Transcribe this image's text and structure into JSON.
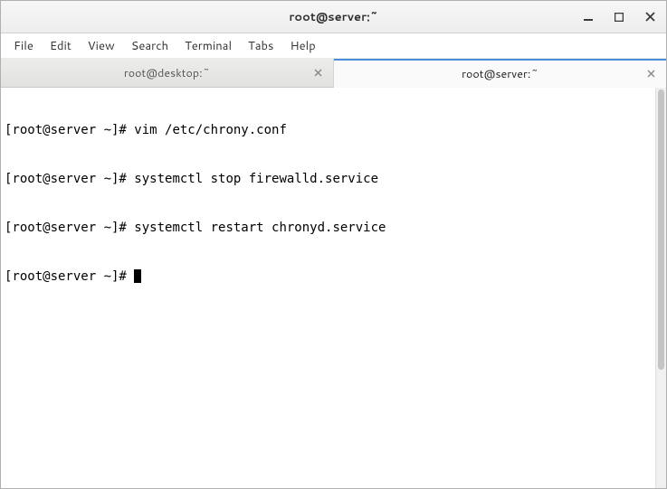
{
  "window": {
    "title": "root@server:~"
  },
  "menubar": {
    "items": [
      {
        "label": "File"
      },
      {
        "label": "Edit"
      },
      {
        "label": "View"
      },
      {
        "label": "Search"
      },
      {
        "label": "Terminal"
      },
      {
        "label": "Tabs"
      },
      {
        "label": "Help"
      }
    ]
  },
  "tabs": [
    {
      "label": "root@desktop:~",
      "active": false
    },
    {
      "label": "root@server:~",
      "active": true
    }
  ],
  "terminal": {
    "lines": [
      {
        "prompt": "[root@server ~]# ",
        "command": "vim /etc/chrony.conf"
      },
      {
        "prompt": "[root@server ~]# ",
        "command": "systemctl stop firewalld.service"
      },
      {
        "prompt": "[root@server ~]# ",
        "command": "systemctl restart chronyd.service"
      },
      {
        "prompt": "[root@server ~]# ",
        "command": "",
        "cursor": true
      }
    ]
  }
}
